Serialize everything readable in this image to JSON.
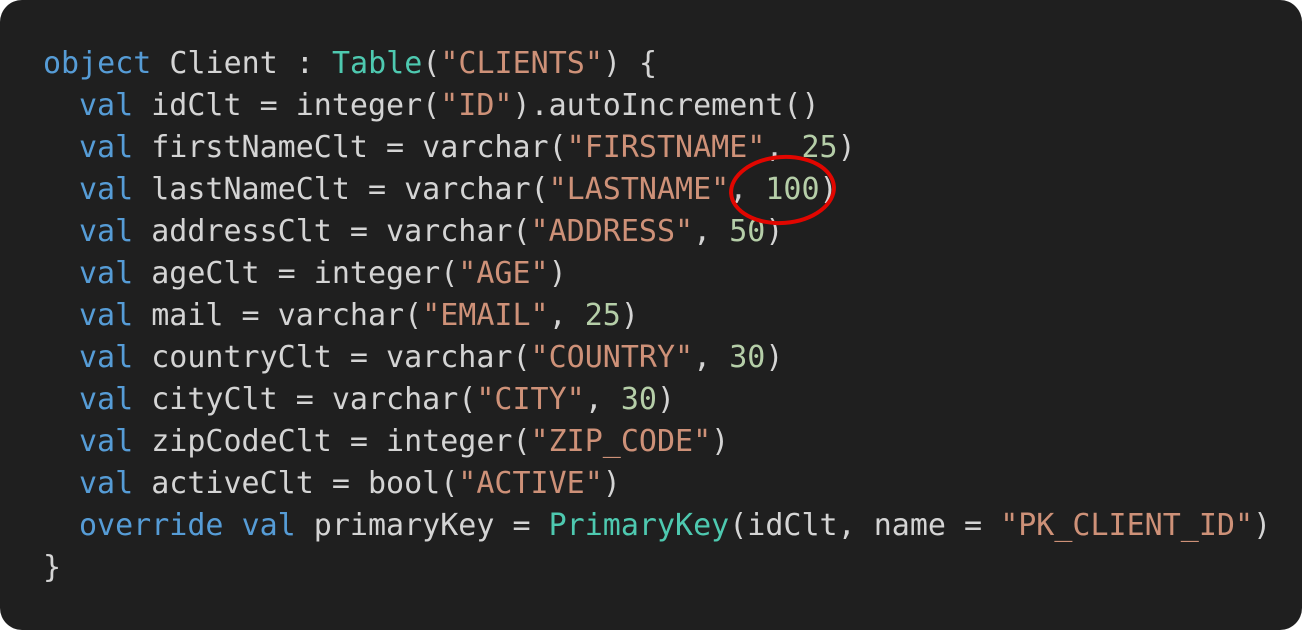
{
  "code": {
    "lines": [
      [
        {
          "t": "object",
          "c": "kw"
        },
        {
          "t": " Client : ",
          "c": "plain"
        },
        {
          "t": "Table",
          "c": "type"
        },
        {
          "t": "(",
          "c": "plain"
        },
        {
          "t": "\"CLIENTS\"",
          "c": "str"
        },
        {
          "t": ") {",
          "c": "plain"
        }
      ],
      [
        {
          "t": "val",
          "c": "kw"
        },
        {
          "t": " idClt = integer(",
          "c": "plain"
        },
        {
          "t": "\"ID\"",
          "c": "str"
        },
        {
          "t": ").autoIncrement()",
          "c": "plain"
        }
      ],
      [
        {
          "t": "val",
          "c": "kw"
        },
        {
          "t": " firstNameClt = varchar(",
          "c": "plain"
        },
        {
          "t": "\"FIRSTNAME\"",
          "c": "str"
        },
        {
          "t": ", ",
          "c": "plain"
        },
        {
          "t": "25",
          "c": "num"
        },
        {
          "t": ")",
          "c": "plain"
        }
      ],
      [
        {
          "t": "val",
          "c": "kw"
        },
        {
          "t": " lastNameClt = varchar(",
          "c": "plain"
        },
        {
          "t": "\"LASTNAME\"",
          "c": "str"
        },
        {
          "t": ", ",
          "c": "plain"
        },
        {
          "t": "100",
          "c": "num"
        },
        {
          "t": ")",
          "c": "plain"
        }
      ],
      [
        {
          "t": "val",
          "c": "kw"
        },
        {
          "t": " addressClt = varchar(",
          "c": "plain"
        },
        {
          "t": "\"ADDRESS\"",
          "c": "str"
        },
        {
          "t": ", ",
          "c": "plain"
        },
        {
          "t": "50",
          "c": "num"
        },
        {
          "t": ")",
          "c": "plain"
        }
      ],
      [
        {
          "t": "val",
          "c": "kw"
        },
        {
          "t": " ageClt = integer(",
          "c": "plain"
        },
        {
          "t": "\"AGE\"",
          "c": "str"
        },
        {
          "t": ")",
          "c": "plain"
        }
      ],
      [
        {
          "t": "val",
          "c": "kw"
        },
        {
          "t": " mail = varchar(",
          "c": "plain"
        },
        {
          "t": "\"EMAIL\"",
          "c": "str"
        },
        {
          "t": ", ",
          "c": "plain"
        },
        {
          "t": "25",
          "c": "num"
        },
        {
          "t": ")",
          "c": "plain"
        }
      ],
      [
        {
          "t": "val",
          "c": "kw"
        },
        {
          "t": " countryClt = varchar(",
          "c": "plain"
        },
        {
          "t": "\"COUNTRY\"",
          "c": "str"
        },
        {
          "t": ", ",
          "c": "plain"
        },
        {
          "t": "30",
          "c": "num"
        },
        {
          "t": ")",
          "c": "plain"
        }
      ],
      [
        {
          "t": "val",
          "c": "kw"
        },
        {
          "t": " cityClt = varchar(",
          "c": "plain"
        },
        {
          "t": "\"CITY\"",
          "c": "str"
        },
        {
          "t": ", ",
          "c": "plain"
        },
        {
          "t": "30",
          "c": "num"
        },
        {
          "t": ")",
          "c": "plain"
        }
      ],
      [
        {
          "t": "val",
          "c": "kw"
        },
        {
          "t": " zipCodeClt = integer(",
          "c": "plain"
        },
        {
          "t": "\"ZIP_CODE\"",
          "c": "str"
        },
        {
          "t": ")",
          "c": "plain"
        }
      ],
      [
        {
          "t": "val",
          "c": "kw"
        },
        {
          "t": " activeClt = bool(",
          "c": "plain"
        },
        {
          "t": "\"ACTIVE\"",
          "c": "str"
        },
        {
          "t": ")",
          "c": "plain"
        }
      ],
      [
        {
          "t": "override",
          "c": "kw"
        },
        {
          "t": " ",
          "c": "plain"
        },
        {
          "t": "val",
          "c": "kw"
        },
        {
          "t": " primaryKey = ",
          "c": "plain"
        },
        {
          "t": "PrimaryKey",
          "c": "type"
        },
        {
          "t": "(idClt, name = ",
          "c": "plain"
        },
        {
          "t": "\"PK_CLIENT_ID\"",
          "c": "str"
        },
        {
          "t": ")",
          "c": "plain"
        }
      ],
      [
        {
          "t": "}",
          "c": "plain"
        }
      ]
    ],
    "indented": [
      false,
      true,
      true,
      true,
      true,
      true,
      true,
      true,
      true,
      true,
      true,
      true,
      false
    ]
  },
  "colors": {
    "background": "#1f1f1f",
    "keyword": "#569cd6",
    "type": "#4ec9b0",
    "string": "#ce9178",
    "number": "#b5cea8",
    "plain": "#d4d4d4",
    "annotation": "#e10600"
  },
  "annotation": {
    "shape": "circle",
    "highlights": "100"
  }
}
